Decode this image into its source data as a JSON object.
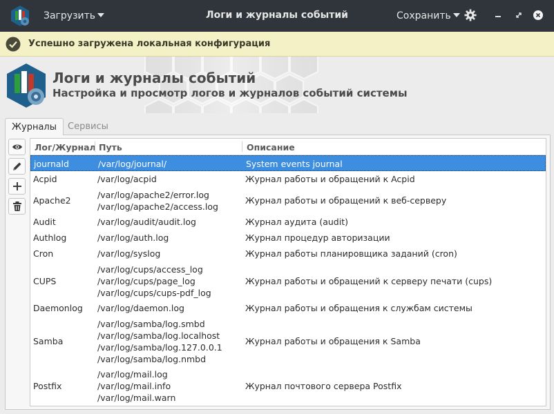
{
  "titlebar": {
    "title": "Логи и журналы событий",
    "load_label": "Загрузить",
    "save_label": "Сохранить"
  },
  "infobar": {
    "message": "Успешно загружена локальная конфигурация"
  },
  "header": {
    "title": "Логи и журналы событий",
    "subtitle": "Настройка и просмотр логов и журналов событий системы"
  },
  "tabs": [
    {
      "label": "Журналы",
      "active": true
    },
    {
      "label": "Сервисы",
      "active": false
    }
  ],
  "table": {
    "columns": [
      "Лог/Журнал",
      "Путь",
      "Описание"
    ],
    "rows": [
      {
        "name": "journald",
        "paths": [
          "/var/log/journal/"
        ],
        "desc": "System events journal",
        "selected": true
      },
      {
        "name": "Acpid",
        "paths": [
          "/var/log/acpid"
        ],
        "desc": "Журнал работы и обращений к Acpid"
      },
      {
        "name": "Apache2",
        "paths": [
          "/var/log/apache2/error.log",
          "/var/log/apache2/access.log"
        ],
        "desc": "Журнал работы и обращений к веб-серверу"
      },
      {
        "name": "Audit",
        "paths": [
          "/var/log/audit/audit.log"
        ],
        "desc": "Журнал аудита (audit)"
      },
      {
        "name": "Authlog",
        "paths": [
          "/var/log/auth.log"
        ],
        "desc": "Журнал процедур авторизации"
      },
      {
        "name": "Cron",
        "paths": [
          "/var/log/syslog"
        ],
        "desc": "Журнал работы планировщика заданий (cron)"
      },
      {
        "name": "CUPS",
        "paths": [
          "/var/log/cups/access_log",
          "/var/log/cups/page_log",
          "/var/log/cups/cups-pdf_log"
        ],
        "desc": "Журнал работы и обращений к серверу печати (cups)"
      },
      {
        "name": "Daemonlog",
        "paths": [
          "/var/log/daemon.log"
        ],
        "desc": "Журнал работы и обращения к службам системы"
      },
      {
        "name": "Samba",
        "paths": [
          "/var/log/samba/log.smbd",
          "/var/log/samba/log.localhost",
          "/var/log/samba/log.127.0.0.1",
          "/var/log/samba/log.nmbd"
        ],
        "desc": "Журнал работы и обращения к Samba"
      },
      {
        "name": "Postfix",
        "paths": [
          "/var/log/mail.log",
          "/var/log/mail.info",
          "/var/log/mail.warn"
        ],
        "desc": "Журнал почтового сервера Postfix"
      }
    ]
  },
  "colors": {
    "titlebar_bg": "#2f353b",
    "infobar_bg": "#f4f1c6",
    "selection": "#3d8ee0",
    "logo_blue": "#1f5f8b",
    "logo_green": "#2e9e3b",
    "logo_red": "#c0392b"
  },
  "icons": {
    "app": "app-logo-icon",
    "gear": "gear-icon",
    "check": "check-circle-icon",
    "view": "eye-icon",
    "edit": "pencil-icon",
    "add": "plus-icon",
    "delete": "trash-icon"
  }
}
